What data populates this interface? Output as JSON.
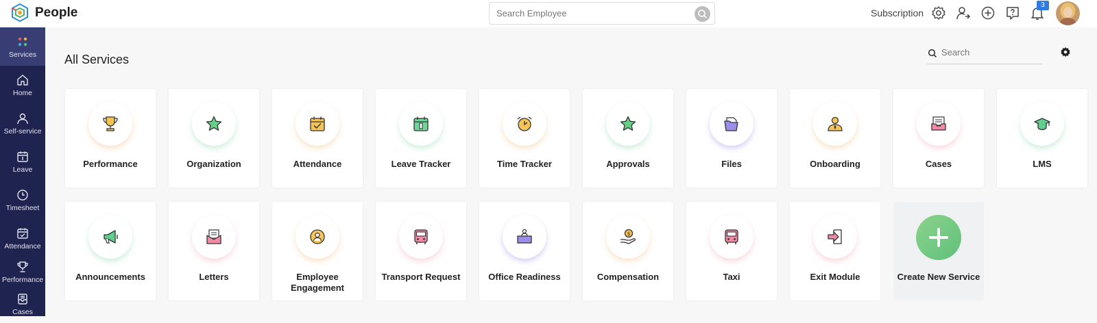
{
  "app": {
    "brand": "People"
  },
  "topbar": {
    "search_placeholder": "Search Employee",
    "subscription": "Subscription",
    "notification_count": "3"
  },
  "sidebar": {
    "items": [
      {
        "label": "Services"
      },
      {
        "label": "Home"
      },
      {
        "label": "Self-service"
      },
      {
        "label": "Leave"
      },
      {
        "label": "Timesheet"
      },
      {
        "label": "Attendance"
      },
      {
        "label": "Performance"
      },
      {
        "label": "Cases"
      }
    ]
  },
  "main": {
    "title": "All Services",
    "search_placeholder": "Search",
    "services": [
      {
        "name": "Performance",
        "icon": "trophy-icon"
      },
      {
        "name": "Organization",
        "icon": "star-icon"
      },
      {
        "name": "Attendance",
        "icon": "calendar-check-icon"
      },
      {
        "name": "Leave Tracker",
        "icon": "leave-calendar-icon"
      },
      {
        "name": "Time Tracker",
        "icon": "alarm-clock-icon"
      },
      {
        "name": "Approvals",
        "icon": "star-icon"
      },
      {
        "name": "Files",
        "icon": "files-icon"
      },
      {
        "name": "Onboarding",
        "icon": "person-badge-icon"
      },
      {
        "name": "Cases",
        "icon": "inbox-tray-icon"
      },
      {
        "name": "LMS",
        "icon": "graduation-cap-icon"
      },
      {
        "name": "Announcements",
        "icon": "megaphone-icon"
      },
      {
        "name": "Letters",
        "icon": "envelope-letter-icon"
      },
      {
        "name": "Employee Engagement",
        "icon": "team-circle-icon"
      },
      {
        "name": "Transport Request",
        "icon": "bus-icon"
      },
      {
        "name": "Office Readiness",
        "icon": "office-desk-icon"
      },
      {
        "name": "Compensation",
        "icon": "hand-coin-icon"
      },
      {
        "name": "Taxi",
        "icon": "bus-icon"
      },
      {
        "name": "Exit Module",
        "icon": "exit-door-icon"
      }
    ],
    "create_label": "Create New Service"
  }
}
